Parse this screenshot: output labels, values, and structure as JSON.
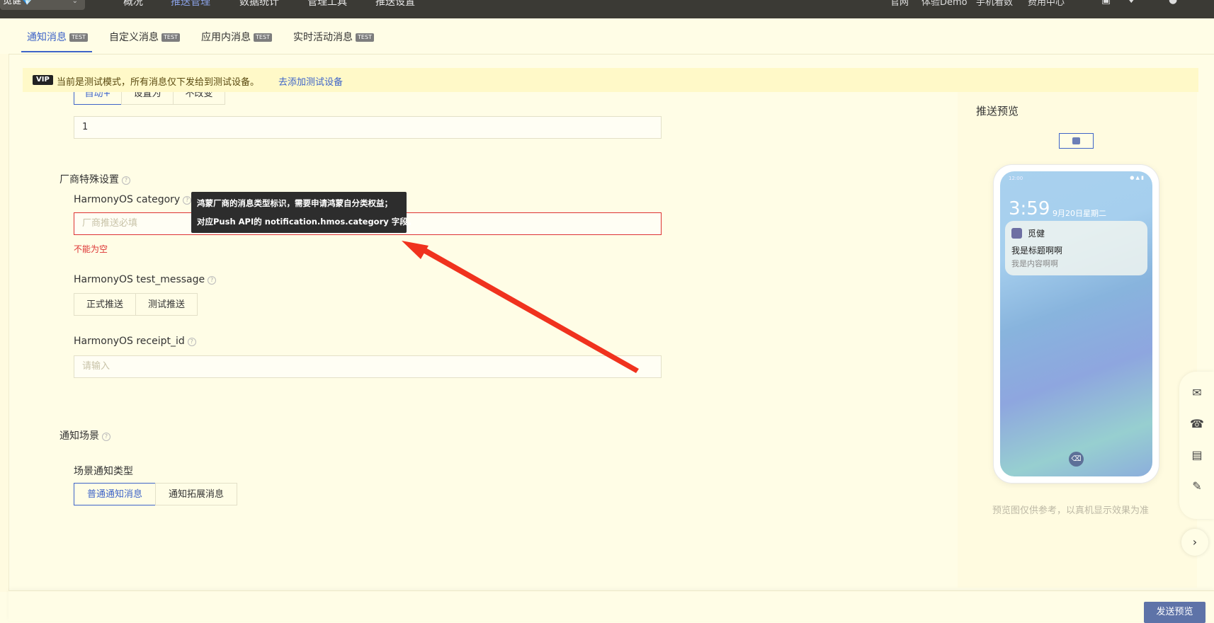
{
  "topbar": {
    "app_name": "觅健💎",
    "nav": [
      "概况",
      "推送管理",
      "数据统计",
      "管理工具",
      "推送设置"
    ],
    "links": [
      "官网",
      "体验Demo",
      "手机看数",
      "费用中心"
    ]
  },
  "tabs": [
    {
      "label": "通知消息",
      "badge": "TEST"
    },
    {
      "label": "自定义消息",
      "badge": "TEST"
    },
    {
      "label": "应用内消息",
      "badge": "TEST"
    },
    {
      "label": "实时活动消息",
      "badge": "TEST"
    }
  ],
  "vip": {
    "badge": "VIP",
    "text": "当前是测试模式，所有消息仅下发给到测试设备。",
    "link": "去添加测试设备"
  },
  "form": {
    "mode_buttons": [
      "自动+",
      "设置为",
      "不改变"
    ],
    "count_value": "1",
    "vendor_section": "厂商特殊设置",
    "category_label": "HarmonyOS category",
    "category_placeholder": "厂商推送必填",
    "category_error": "不能为空",
    "test_message_label": "HarmonyOS test_message",
    "test_message_options": [
      "正式推送",
      "测试推送"
    ],
    "receipt_label": "HarmonyOS receipt_id",
    "receipt_placeholder": "请输入",
    "scene_section": "通知场景",
    "scene_type_label": "场景通知类型",
    "scene_options": [
      "普通通知消息",
      "通知拓展消息"
    ]
  },
  "tooltip": {
    "line1": "鸿蒙厂商的消息类型标识，需要申请鸿蒙自分类权益；",
    "line2": "对应Push API的 notification.hmos.category 字段。"
  },
  "preview": {
    "title": "推送预览",
    "status_time": "12:00",
    "clock": "3:59",
    "date": "9月20日星期二",
    "app_name": "觅健",
    "notif_title": "我是标题啊啊",
    "notif_content": "我是内容啊啊",
    "note": "预览图仅供参考，以真机显示效果为准"
  },
  "footer": {
    "send_label": "发送预览"
  }
}
